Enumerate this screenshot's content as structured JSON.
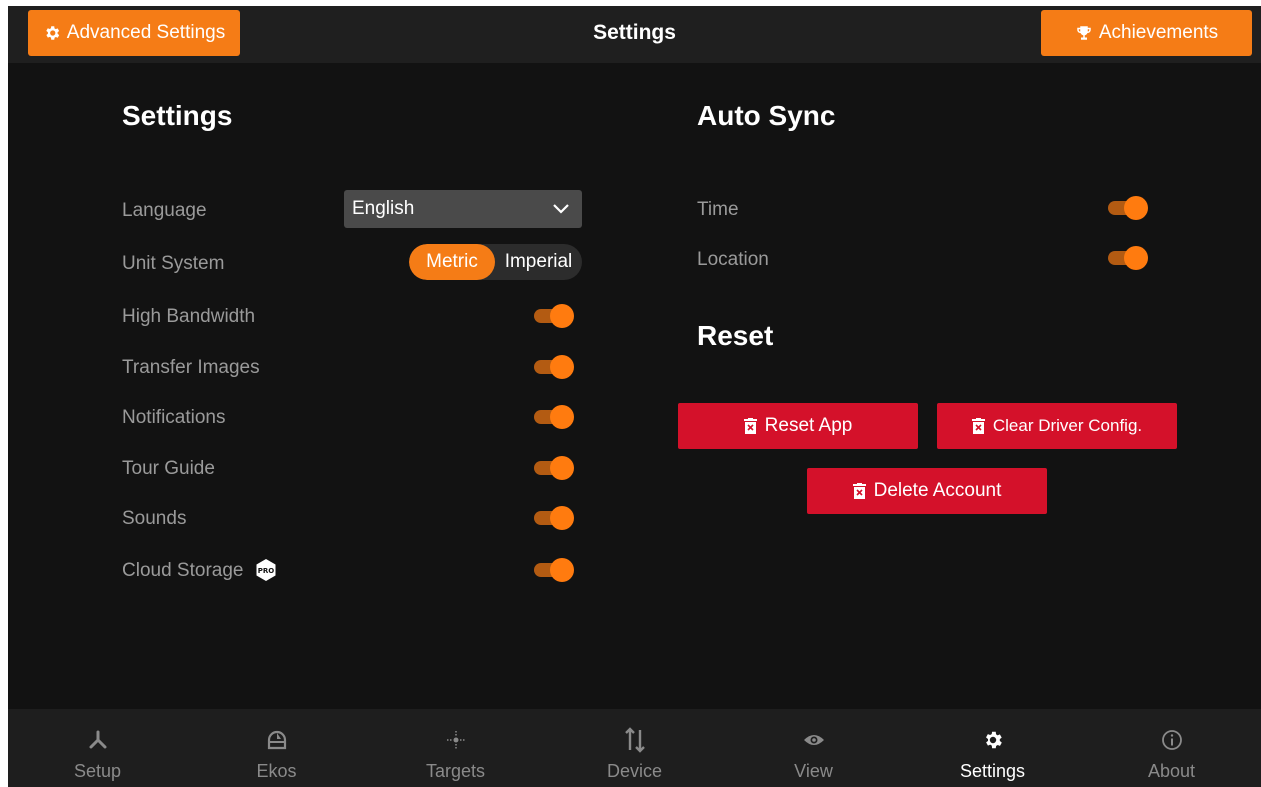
{
  "header": {
    "title": "Settings",
    "advanced_label": "Advanced Settings",
    "achievements_label": "Achievements"
  },
  "settings": {
    "title": "Settings",
    "language_label": "Language",
    "language_value": "English",
    "unit_label": "Unit System",
    "unit_options": [
      "Metric",
      "Imperial"
    ],
    "unit_selected": "Metric",
    "toggles": [
      {
        "label": "High Bandwidth",
        "on": true
      },
      {
        "label": "Transfer Images",
        "on": true
      },
      {
        "label": "Notifications",
        "on": true
      },
      {
        "label": "Tour Guide",
        "on": true
      },
      {
        "label": "Sounds",
        "on": true
      },
      {
        "label": "Cloud Storage",
        "on": true
      }
    ],
    "pro_badge": "PRO"
  },
  "auto_sync": {
    "title": "Auto Sync",
    "items": [
      {
        "label": "Time",
        "on": true
      },
      {
        "label": "Location",
        "on": true
      }
    ]
  },
  "reset": {
    "title": "Reset",
    "reset_app": "Reset App",
    "clear_driver": "Clear Driver Config.",
    "delete_account": "Delete Account"
  },
  "nav": {
    "items": [
      {
        "label": "Setup",
        "icon": "setup-icon"
      },
      {
        "label": "Ekos",
        "icon": "ekos-dome-icon"
      },
      {
        "label": "Targets",
        "icon": "targets-icon"
      },
      {
        "label": "Device",
        "icon": "device-arrows-icon"
      },
      {
        "label": "View",
        "icon": "eye-icon"
      },
      {
        "label": "Settings",
        "icon": "gear-icon"
      },
      {
        "label": "About",
        "icon": "info-icon"
      }
    ],
    "active": "Settings"
  },
  "colors": {
    "accent": "#f57c16",
    "danger": "#d4112a",
    "background": "#121212"
  }
}
